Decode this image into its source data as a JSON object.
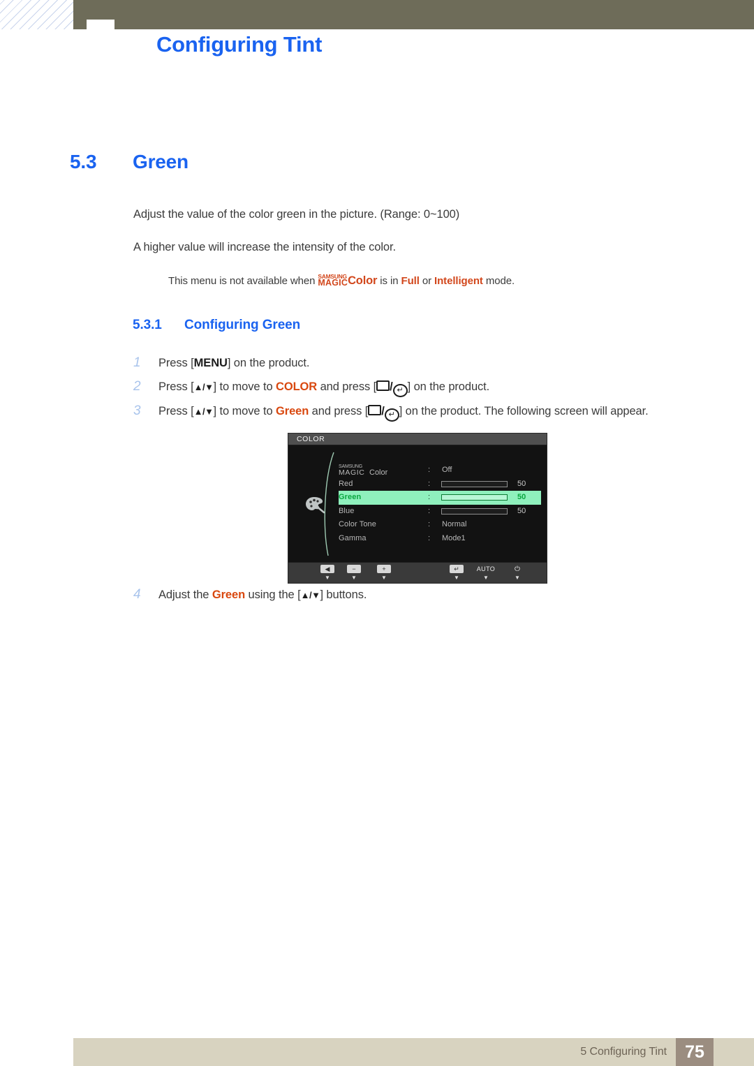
{
  "header": {
    "title": "Configuring Tint",
    "title_color": "#1a63f0",
    "bar_color": "#6e6c59"
  },
  "section": {
    "number": "5.3",
    "title": "Green"
  },
  "paragraphs": {
    "p1": "Adjust the value of the color green in the picture. (Range: 0~100)",
    "p2": "A higher value will increase the intensity of the color."
  },
  "note": {
    "lead": "This menu is not available when ",
    "logo_top": "SAMSUNG",
    "logo_bottom": "MAGIC",
    "logo_word": "Color",
    "mid": " is in ",
    "mode_full": "Full",
    "or": " or ",
    "mode_intelligent": "Intelligent",
    "tail": " mode.",
    "accent_color": "#d2471c"
  },
  "subsection": {
    "number": "5.3.1",
    "title": "Configuring Green"
  },
  "steps": [
    {
      "num": "1",
      "pre": "Press [",
      "key": "MENU",
      "post": "] on the product."
    },
    {
      "num": "2",
      "pre": "Press [",
      "arrows": "▲/▼",
      "mid": "] to move to ",
      "target": "COLOR",
      "mid2": " and press [",
      "icon_slash": "/",
      "post": "] on the product."
    },
    {
      "num": "3",
      "pre": "Press [",
      "arrows": "▲/▼",
      "mid": "] to move to ",
      "target": "Green",
      "mid2": " and press [",
      "icon_slash": "/",
      "post": "] on the product. The following screen will appear."
    },
    {
      "num": "4",
      "pre": "Adjust the ",
      "target": "Green",
      "mid": " using the [",
      "arrows": "▲/▼",
      "post": "] buttons."
    }
  ],
  "osd": {
    "title": "COLOR",
    "magic_top": "SAMSUNG",
    "magic_bottom": "MAGIC",
    "magic_label": "Color",
    "colon": ":",
    "rows": [
      {
        "label": "MAGIC Color",
        "value": "Off",
        "type": "text",
        "number": ""
      },
      {
        "label": "Red",
        "value": "",
        "type": "slider",
        "number": "50",
        "fill_percent": 50
      },
      {
        "label": "Green",
        "value": "",
        "type": "slider",
        "number": "50",
        "fill_percent": 50,
        "selected": true
      },
      {
        "label": "Blue",
        "value": "",
        "type": "slider",
        "number": "50",
        "fill_percent": 50
      },
      {
        "label": "Color Tone",
        "value": "Normal",
        "type": "text",
        "number": ""
      },
      {
        "label": "Gamma",
        "value": "Mode1",
        "type": "text",
        "number": ""
      }
    ],
    "toolbar": [
      {
        "name": "back",
        "glyph": "◀",
        "tri": "▼"
      },
      {
        "name": "minus",
        "glyph": "−",
        "tri": "▼"
      },
      {
        "name": "plus",
        "glyph": "+",
        "tri": "▼"
      },
      {
        "name": "enter",
        "glyph": "↵",
        "tri": "▼"
      },
      {
        "name": "auto",
        "glyph": "AUTO",
        "tri": "▼"
      },
      {
        "name": "power",
        "glyph": "⏻",
        "tri": "▼"
      }
    ],
    "highlight_color": "#8ff0bd",
    "fill_color": "#12c223"
  },
  "footer": {
    "text": "5 Configuring Tint",
    "page": "75",
    "bar_color": "#d8d3c0",
    "page_box_color": "#9b8d80"
  }
}
